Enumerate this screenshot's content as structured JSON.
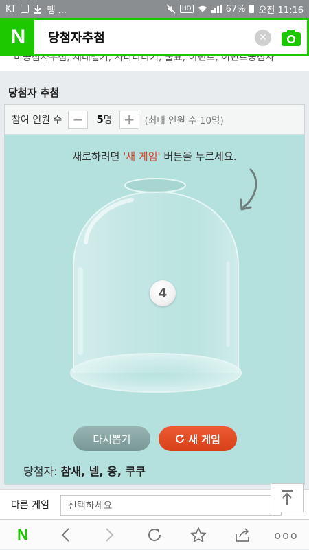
{
  "status_bar": {
    "carrier": "KT",
    "notification_text": "땡 ...",
    "battery": "67%",
    "time": "오전 11:16"
  },
  "search": {
    "query": "당첨자추첨",
    "logo": "N"
  },
  "cut_text": "미중점사우점, 제네법기, 사다다다기, 물표, 이민트, 이민트중점사",
  "section": {
    "title": "당첨자 추첨"
  },
  "controls": {
    "participants_label": "참여 인원 수",
    "minus": "−",
    "count": "5",
    "unit": "명",
    "plus": "+",
    "max_note": "(최대 인원 수 10명)"
  },
  "instruction": {
    "before": "새로하려면 ",
    "highlight": "'새 게임'",
    "after": " 버튼을 누르세요."
  },
  "ball": {
    "number": "4"
  },
  "buttons": {
    "redraw": "다시뽑기",
    "new_game": "새 게임"
  },
  "winners": {
    "label": "당첨자:",
    "names": "참새, 넬, 옹, 쿠쿠"
  },
  "other_game": {
    "label": "다른 게임",
    "select_placeholder": "선택하세요"
  },
  "bottom_nav": {
    "home_logo": "N",
    "more": "ooo"
  },
  "colors": {
    "naver_green": "#1ec800",
    "panel_teal": "#b4e0dd",
    "highlight_red": "#e0462a",
    "new_game_orange": "#e04a22",
    "redraw_gray": "#889f9d"
  },
  "icons": [
    "image-icon",
    "download-icon",
    "mute-icon",
    "hd-icon",
    "wifi-icon",
    "signal-icon",
    "battery-icon",
    "close-icon",
    "camera-icon",
    "refresh-icon",
    "curved-arrow-icon",
    "arrow-up-icon",
    "back-icon",
    "forward-icon",
    "reload-icon",
    "star-icon",
    "share-icon",
    "more-icon"
  ]
}
